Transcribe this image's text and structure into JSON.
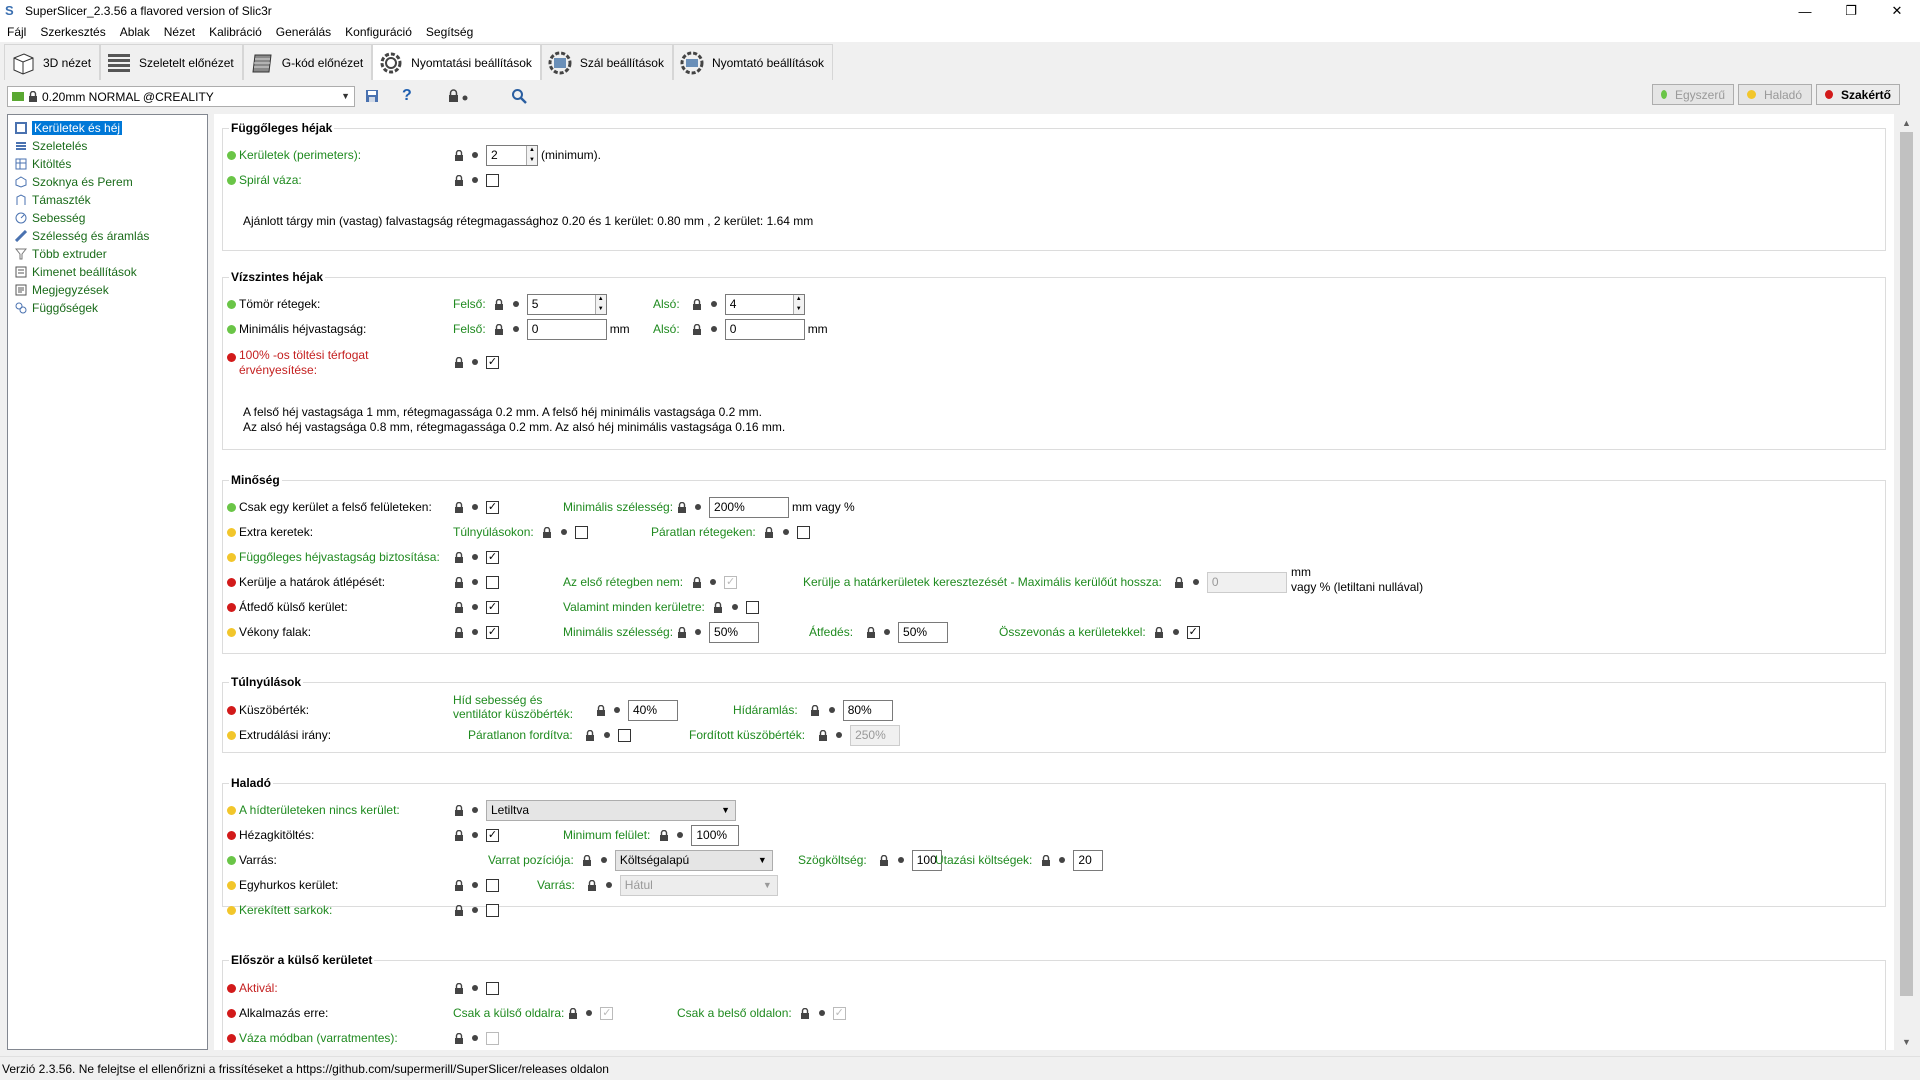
{
  "window": {
    "title": "SuperSlicer_2.3.56 a flavored version of Slic3r"
  },
  "menu": [
    "Fájl",
    "Szerkesztés",
    "Ablak",
    "Nézet",
    "Kalibráció",
    "Generálás",
    "Konfiguráció",
    "Segítség"
  ],
  "tabs": [
    {
      "label": "3D nézet",
      "icon": "cube-icon"
    },
    {
      "label": "Szeletelt előnézet",
      "icon": "layers-icon"
    },
    {
      "label": "G-kód előnézet",
      "icon": "gcode-icon"
    },
    {
      "label": "Nyomtatási beállítások",
      "icon": "gear-icon"
    },
    {
      "label": "Szál beállítások",
      "icon": "filament-icon"
    },
    {
      "label": "Nyomtató beállítások",
      "icon": "printer-icon"
    }
  ],
  "preset": {
    "value": "0.20mm NORMAL @CREALITY"
  },
  "modes": [
    "Egyszerű",
    "Haladó",
    "Szakértő"
  ],
  "sidebar": [
    "Kerületek és héj",
    "Szeletelés",
    "Kitöltés",
    "Szoknya és Perem",
    "Támaszték",
    "Sebesség",
    "Szélesség és áramlás",
    "Több extruder",
    "Kimenet beállítások",
    "Megjegyzések",
    "Függőségek"
  ],
  "vertical_shells": {
    "title": "Függőleges héjak",
    "perimeters_label": "Kerületek (perimeters):",
    "perimeters_value": "2",
    "perimeters_suffix": "(minimum).",
    "spiral_label": "Spirál váza:",
    "note": "Ajánlott tárgy min (vastag) falvastagság rétegmagassághoz 0.20 és 1 kerület: 0.80 mm , 2 kerület: 1.64 mm"
  },
  "horizontal_shells": {
    "title": "Vízszintes héjak",
    "solid_layers_label": "Tömör rétegek:",
    "top_label": "Felső:",
    "bottom_label": "Alsó:",
    "solid_top": "5",
    "solid_bottom": "4",
    "min_thickness_label": "Minimális héjvastagság:",
    "min_top": "0",
    "min_bottom": "0",
    "unit_mm": "mm",
    "enforce_label_1": "100% -os töltési térfogat",
    "enforce_label_2": "érvényesítése:",
    "note_1": "A felső héj vastagsága 1 mm, rétegmagassága 0.2 mm. A felső héj minimális vastagsága 0.2 mm.",
    "note_2": "Az alsó héj vastagsága 0.8 mm, rétegmagassága 0.2 mm. Az alsó héj minimális vastagsága 0.16 mm."
  },
  "quality": {
    "title": "Minőség",
    "only_one_perimeter_label": "Csak egy kerület a felső felületeken:",
    "min_width_label": "Minimális szélesség:",
    "min_width_value": "200%",
    "min_width_unit": "mm vagy %",
    "extra_perimeters_label": "Extra keretek:",
    "overhangs_label": "Túlnyúlásokon:",
    "odd_layers_label": "Páratlan rétegeken:",
    "ensure_vertical_label": "Függőleges héjvastagság biztosítása:",
    "avoid_crossing_label": "Kerülje a határok átlépését:",
    "not_first_layer_label": "Az első rétegben nem:",
    "max_detour_label": "Kerülje a határkerületek keresztezését - Maximális kerülőút hossza:",
    "max_detour_value": "0",
    "max_detour_unit_1": "mm",
    "max_detour_unit_2": "vagy % (letiltani nullával)",
    "overlapping_label": "Átfedő külső kerület:",
    "every_perimeter_label": "Valamint minden kerületre:",
    "thin_walls_label": "Vékony falak:",
    "thin_min_width_value": "50%",
    "overlap_label": "Átfedés:",
    "overlap_value": "50%",
    "merge_label": "Összevonás a kerületekkel:"
  },
  "overhangs": {
    "title": "Túlnyúlások",
    "threshold_label": "Küszöbérték:",
    "bridge_speed_label_1": "Híd sebesség és",
    "bridge_speed_label_2": "ventilátor küszöbérték:",
    "bridge_speed_value": "40%",
    "bridge_flow_label": "Hídáramlás:",
    "bridge_flow_value": "80%",
    "extrusion_dir_label": "Extrudálási irány:",
    "reversed_odd_label": "Páratlanon fordítva:",
    "reversed_threshold_label": "Fordított küszöbérték:",
    "reversed_threshold_value": "250%"
  },
  "advanced": {
    "title": "Haladó",
    "no_perimeter_bridge_label": "A hídterületeken nincs kerület:",
    "no_perimeter_bridge_value": "Letiltva",
    "gap_fill_label": "Hézagkitöltés:",
    "min_surface_label": "Minimum felület:",
    "min_surface_value": "100%",
    "seam_label": "Varrás:",
    "seam_position_label": "Varrat pozíciója:",
    "seam_position_value": "Költségalapú",
    "angle_cost_label": "Szögköltség:",
    "angle_cost_value": "100",
    "travel_cost_label": "Utazási költségek:",
    "travel_cost_value": "20",
    "one_loop_label": "Egyhurkos kerület:",
    "seam2_label": "Varrás:",
    "seam2_value": "Hátul",
    "rounded_corners_label": "Kerekített sarkok:"
  },
  "external_first": {
    "title": "Először a külső kerületet",
    "activate_label": "Aktivál:",
    "apply_label": "Alkalmazás erre:",
    "outer_only_label": "Csak a külső oldalra:",
    "inner_only_label": "Csak a belső oldalon:",
    "vase_label": "Váza módban (varratmentes):"
  },
  "status": {
    "text": "Verzió 2.3.56. Ne felejtse el ellenőrizni a frissítéseket a https://github.com/supermerill/SuperSlicer/releases oldalon"
  },
  "colors": {
    "green": "#6ac547",
    "yellow": "#f2c62b",
    "red": "#d21a1a",
    "selection": "#0078d7"
  }
}
